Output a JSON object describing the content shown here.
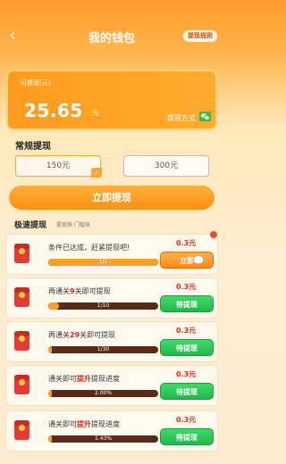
{
  "header": {
    "back": "‹",
    "title": "我的钱包",
    "rules_label": "提现规则"
  },
  "balance": {
    "label": "可提现(元)",
    "value": "25.65",
    "unit": "元",
    "method_label": "提现方式",
    "method_icon": "wechat-icon"
  },
  "regular": {
    "title": "常规提现",
    "options": [
      {
        "label": "150元",
        "selected": true
      },
      {
        "label": "300元",
        "selected": false
      }
    ],
    "check": "✓",
    "withdraw_label": "立即提现"
  },
  "fast": {
    "title": "极速提现",
    "subtitle": "提现快 门槛快",
    "tasks": [
      {
        "text_before": "条件已达成，",
        "text_hl": "",
        "text_after": "赶紧提现吧!",
        "reward": "0.3元",
        "progress_text": "1/1",
        "progress": 1.0,
        "button": "立即",
        "button_type": "go"
      },
      {
        "text_before": "再通关",
        "text_hl": "9",
        "text_after": "关即可提现",
        "reward": "0.3元",
        "progress_text": "1/10",
        "progress": 0.1,
        "button": "待提现",
        "button_type": "wait"
      },
      {
        "text_before": "再通关",
        "text_hl": "29",
        "text_after": "关即可提现",
        "reward": "0.3元",
        "progress_text": "1/30",
        "progress": 0.033,
        "button": "待提现",
        "button_type": "wait"
      },
      {
        "text_before": "通关即可",
        "text_hl": "提升",
        "text_after": "提现进度",
        "reward": "0.3元",
        "progress_text": "2.00%",
        "progress": 0.02,
        "button": "待提现",
        "button_type": "wait"
      },
      {
        "text_before": "通关即可",
        "text_hl": "提升",
        "text_after": "提现进度",
        "reward": "0.3元",
        "progress_text": "1.43%",
        "progress": 0.0143,
        "button": "待提现",
        "button_type": "wait"
      }
    ]
  }
}
